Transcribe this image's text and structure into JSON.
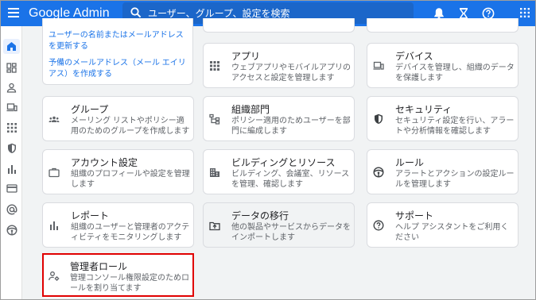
{
  "header": {
    "brand": "Google Admin",
    "search_placeholder": "ユーザー、グループ、設定を検索"
  },
  "links": {
    "search_user": "ユーザーの名前またはメールアドレスを更新する",
    "alias": "予備のメールアドレス（メール エイリアス）を作成する"
  },
  "cards": {
    "apps": {
      "title": "アプリ",
      "desc": "ウェブアプリやモバイルアプリのアクセスと設定を管理します"
    },
    "devices": {
      "title": "デバイス",
      "desc": "デバイスを管理し、組織のデータを保護します"
    },
    "groups": {
      "title": "グループ",
      "desc": "メーリング リストやポリシー適用のためのグループを作成します"
    },
    "org_units": {
      "title": "組織部門",
      "desc": "ポリシー適用のためユーザーを部門に編成します"
    },
    "security": {
      "title": "セキュリティ",
      "desc": "セキュリティ設定を行い、アラートや分析情報を確認します"
    },
    "account": {
      "title": "アカウント設定",
      "desc": "組織のプロフィールや設定を管理します"
    },
    "buildings": {
      "title": "ビルディングとリソース",
      "desc": "ビルディング、会議室、リソースを管理、確認します"
    },
    "rules": {
      "title": "ルール",
      "desc": "アラートとアクションの設定ルールを管理します"
    },
    "reports": {
      "title": "レポート",
      "desc": "組織のユーザーと管理者のアクティビティをモニタリングします"
    },
    "migration": {
      "title": "データの移行",
      "desc": "他の製品やサービスからデータをインポートします"
    },
    "support": {
      "title": "サポート",
      "desc": "ヘルプ アシスタントをご利用ください"
    },
    "admin_roles": {
      "title": "管理者ロール",
      "desc": "管理コンソール権限設定のためロールを割り当てます"
    }
  },
  "colors": {
    "topbar": "#1a73e8",
    "highlight_box": "#e00000",
    "link": "#1a73e8"
  }
}
